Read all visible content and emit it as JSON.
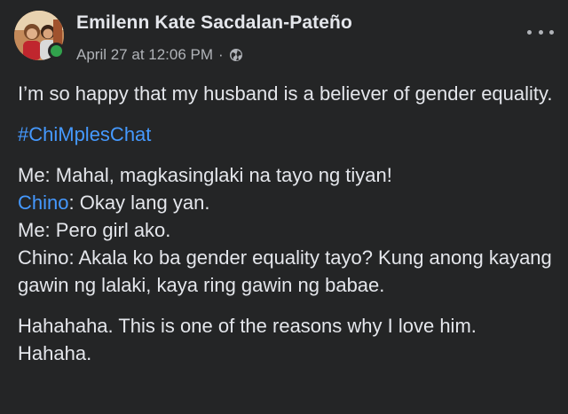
{
  "post": {
    "author": "Emilenn Kate Sacdalan-Pateño",
    "timestamp": "April 27 at 12:06 PM",
    "separator": "·",
    "privacy_icon": "globe-icon",
    "more_icon": "more-horizontal-icon",
    "online": true,
    "paragraph1": "I’m so happy that my husband is a believer of gender equality.",
    "hashtag": "#ChiMplesChat",
    "conversation": [
      {
        "text": "Me: Mahal, magkasinglaki na tayo ng tiyan!"
      },
      {
        "mention": "Chino",
        "text": ": Okay lang yan."
      },
      {
        "text": "Me: Pero girl ako."
      },
      {
        "text": "Chino: Akala ko ba gender equality tayo? Kung anong kayang gawin ng lalaki, kaya ring gawin ng babae."
      }
    ],
    "closing": "Hahahaha. This is one of the reasons why I love him. Hahaha."
  },
  "colors": {
    "background": "#242526",
    "text": "#e4e6eb",
    "secondary_text": "#b0b3b8",
    "link": "#4599ff",
    "online_dot": "#31a24c"
  }
}
